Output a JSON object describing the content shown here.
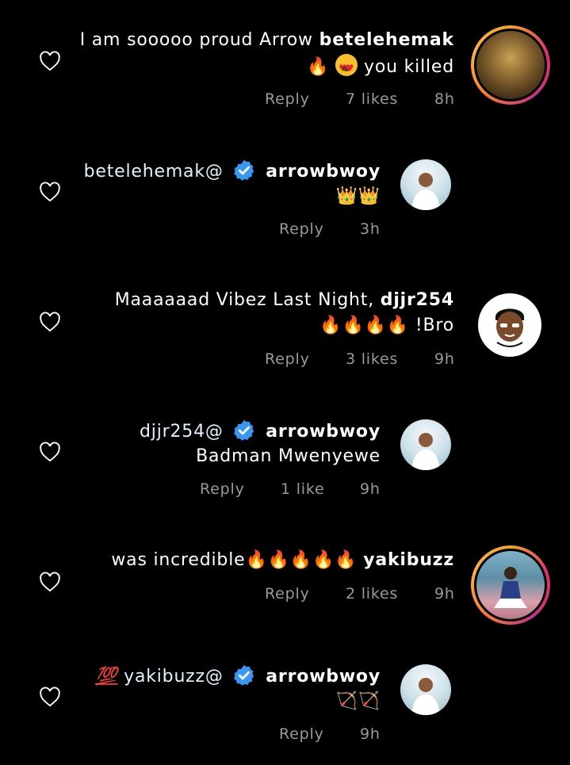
{
  "comments": [
    {
      "line1_text": "I am sooooo proud Arrow",
      "username": "betelehemak",
      "line2_text": "you killed",
      "reply": "Reply",
      "likes": "7 likes",
      "time": "8h",
      "emojis": [
        "fire",
        "heart-eyes"
      ]
    },
    {
      "mention": "betelehemak@",
      "username": "arrowbwoy",
      "line2_text": "👑👑",
      "reply": "Reply",
      "time": "3h",
      "verified": true
    },
    {
      "line1_text": "Maaaaaad Vibez Last Night,",
      "username": "djjr254",
      "line2_text": "!Bro",
      "reply": "Reply",
      "likes": "3 likes",
      "time": "9h",
      "emojis": [
        "fire",
        "fire",
        "fire",
        "fire"
      ]
    },
    {
      "mention": "djjr254@",
      "username": "arrowbwoy",
      "line2_text": "Badman Mwenyewe",
      "reply": "Reply",
      "likes": "1 like",
      "time": "9h",
      "verified": true
    },
    {
      "line1_text": "was incredible",
      "username": "yakibuzz",
      "reply": "Reply",
      "likes": "2 likes",
      "time": "9h",
      "emojis": [
        "fire",
        "fire",
        "fire",
        "fire",
        "fire"
      ]
    },
    {
      "prefix_emoji": "💯",
      "mention": "yakibuzz@",
      "username": "arrowbwoy",
      "line2_text": "🏹🏹",
      "reply": "Reply",
      "time": "9h",
      "verified": true
    }
  ],
  "icons": {
    "heart": "heart-outline-icon",
    "verified": "verified-badge-icon"
  },
  "colors": {
    "background": "#000000",
    "text": "#ffffff",
    "meta": "#9a9a9a",
    "verified": "#3897f0",
    "story_ring": "#e1306c"
  }
}
